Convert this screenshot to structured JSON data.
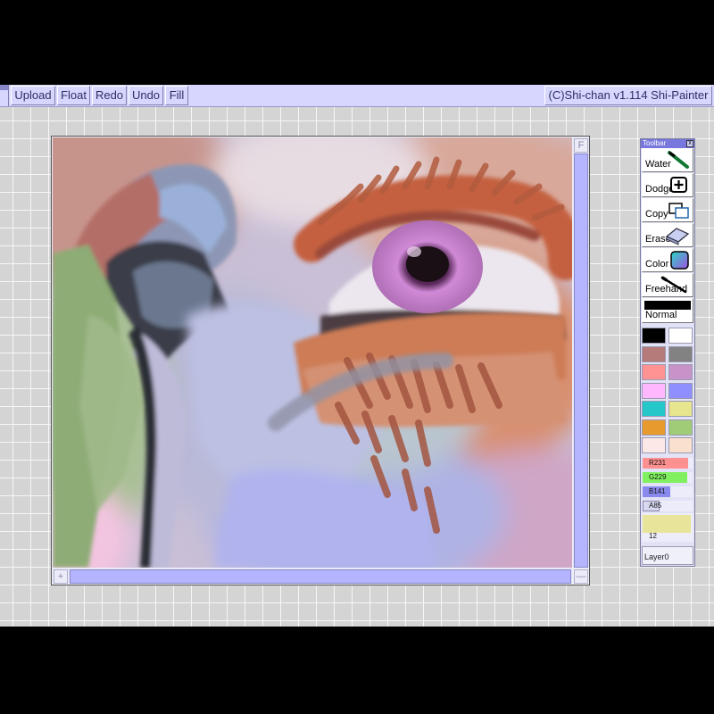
{
  "menu": {
    "upload": "Upload",
    "float": "Float",
    "redo": "Redo",
    "undo": "Undo",
    "fill": "Fill",
    "copyright": "(C)Shi-chan v1.114 Shi-Painter"
  },
  "toolbar": {
    "title": "Toolbar",
    "close": "x",
    "tools": {
      "water": "Water",
      "dodge": "Dodge",
      "copy": "Copy",
      "eraser": "Erase",
      "color": "Color",
      "freehand": "Freehand",
      "normal": "Normal"
    },
    "palette": [
      "#000000",
      "#ffffff",
      "#b57a7a",
      "#828282",
      "#ff9393",
      "#c893c8",
      "#ffb8ff",
      "#8f8fff",
      "#25c7c9",
      "#e8e58f",
      "#e79a2e",
      "#a0cc78",
      "#fde8e8",
      "#fae1cf"
    ],
    "rgb": {
      "r": "R231",
      "g": "G229",
      "b": "B141",
      "a": "A85"
    },
    "rgb_values": {
      "r": 231,
      "g": 229,
      "b": 141,
      "a": 85
    },
    "size": "12",
    "layer": "Layer0"
  },
  "scroll": {
    "corner_v": "F",
    "corner_h": "+",
    "corner_h_end": "—"
  },
  "colors": {
    "accent": "#b4b4ff",
    "menu_bg": "#d6d6ff"
  }
}
